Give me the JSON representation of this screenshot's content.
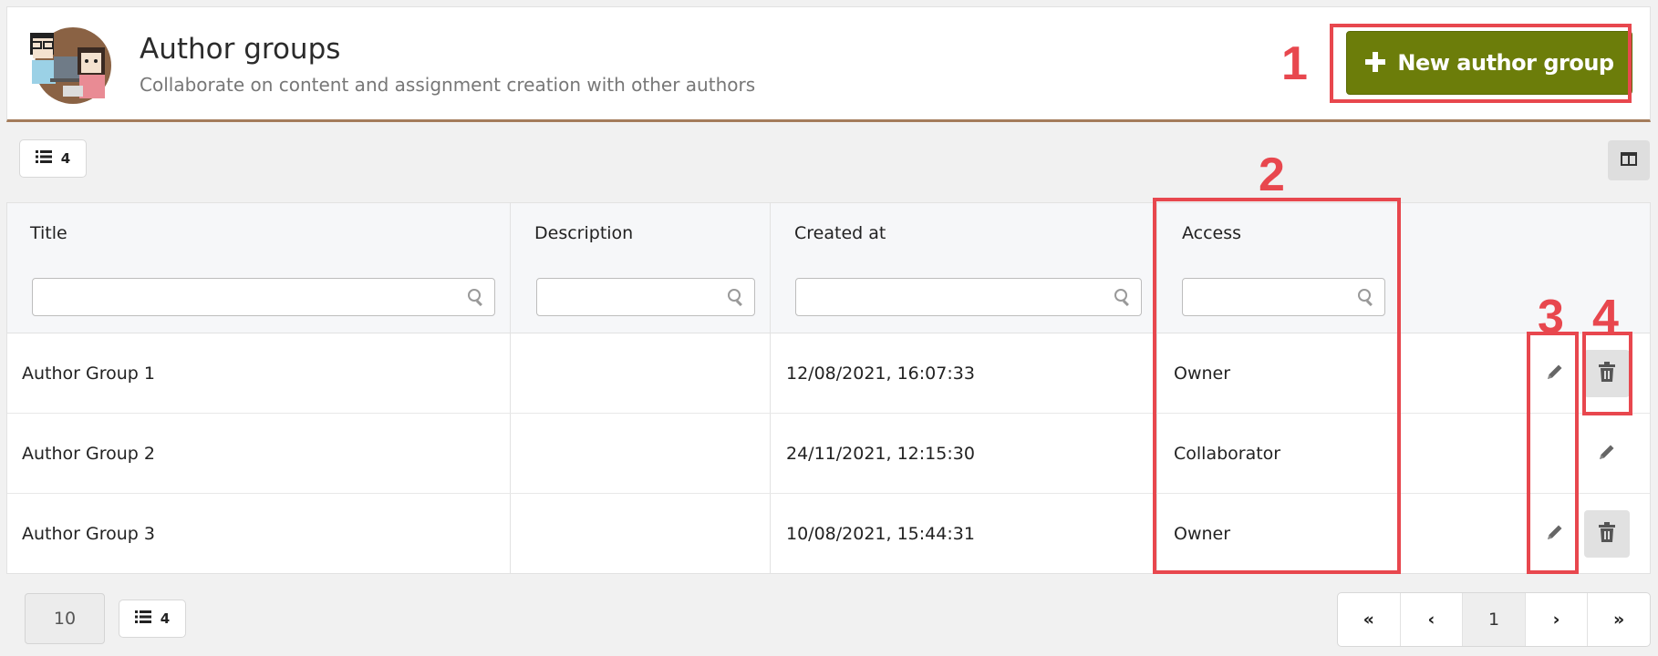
{
  "header": {
    "title": "Author groups",
    "subtitle": "Collaborate on content and assignment creation with other authors",
    "new_button_label": "New author group",
    "new_button_icon": "plus-icon"
  },
  "toolbar": {
    "item_count": "4",
    "item_count_icon": "list-icon",
    "columns_toggle_icon": "columns-icon"
  },
  "table": {
    "columns": [
      "Title",
      "Description",
      "Created at",
      "Access"
    ],
    "rows": [
      {
        "title": "Author Group 1",
        "description": "",
        "created_at": "12/08/2021, 16:07:33",
        "access": "Owner",
        "can_delete": true
      },
      {
        "title": "Author Group 2",
        "description": "",
        "created_at": "24/11/2021, 12:15:30",
        "access": "Collaborator",
        "can_delete": false
      },
      {
        "title": "Author Group 3",
        "description": "",
        "created_at": "10/08/2021, 15:44:31",
        "access": "Owner",
        "can_delete": true
      }
    ]
  },
  "footer": {
    "page_size": "10",
    "item_count": "4",
    "pagination": {
      "first": "«",
      "prev": "‹",
      "current": "1",
      "next": "›",
      "last": "»"
    }
  },
  "annotations": [
    "1",
    "2",
    "3",
    "4"
  ],
  "colors": {
    "accent": "#6c7d0a",
    "annotation": "#e8474e",
    "header_border": "#a47c5b"
  }
}
